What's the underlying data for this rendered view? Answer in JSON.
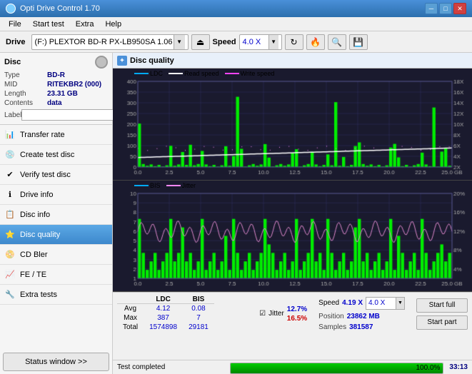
{
  "titleBar": {
    "title": "Opti Drive Control 1.70",
    "minBtn": "─",
    "maxBtn": "□",
    "closeBtn": "✕"
  },
  "menuBar": {
    "items": [
      "File",
      "Start test",
      "Extra",
      "Help"
    ]
  },
  "toolbar": {
    "driveLabel": "Drive",
    "driveValue": "(F:) PLEXTOR BD-R  PX-LB950SA 1.06",
    "speedLabel": "Speed",
    "speedValue": "4.0 X"
  },
  "discPanel": {
    "title": "Disc",
    "type": "BD-R",
    "mid": "RITEKBR2 (000)",
    "length": "23.31 GB",
    "contents": "data",
    "labelPlaceholder": ""
  },
  "navItems": [
    {
      "id": "transfer-rate",
      "label": "Transfer rate",
      "icon": "📊"
    },
    {
      "id": "create-test-disc",
      "label": "Create test disc",
      "icon": "💿"
    },
    {
      "id": "verify-test-disc",
      "label": "Verify test disc",
      "icon": "✔"
    },
    {
      "id": "drive-info",
      "label": "Drive info",
      "icon": "ℹ"
    },
    {
      "id": "disc-info",
      "label": "Disc info",
      "icon": "📋"
    },
    {
      "id": "disc-quality",
      "label": "Disc quality",
      "icon": "⭐",
      "active": true
    },
    {
      "id": "cd-bler",
      "label": "CD Bler",
      "icon": "📀"
    },
    {
      "id": "fe-te",
      "label": "FE / TE",
      "icon": "📈"
    },
    {
      "id": "extra-tests",
      "label": "Extra tests",
      "icon": "🔧"
    }
  ],
  "statusWindowBtn": "Status window >>",
  "discQuality": {
    "title": "Disc quality",
    "legend": {
      "ldc": "LDC",
      "readSpeed": "Read speed",
      "writeSpeed": "Write speed"
    },
    "legend2": {
      "bis": "BIS",
      "jitter": "Jitter"
    },
    "topChart": {
      "yMax": 400,
      "yAxisRight": [
        "18X",
        "16X",
        "14X",
        "12X",
        "10X",
        "8X",
        "6X",
        "4X",
        "2X"
      ],
      "xLabels": [
        "0.0",
        "2.5",
        "5.0",
        "7.5",
        "10.0",
        "12.5",
        "15.0",
        "17.5",
        "20.0",
        "22.5",
        "25.0 GB"
      ]
    },
    "bottomChart": {
      "yMax": 10,
      "yAxisRight": [
        "20%",
        "16%",
        "12%",
        "8%",
        "4%"
      ],
      "xLabels": [
        "0.0",
        "2.5",
        "5.0",
        "7.5",
        "10.0",
        "12.5",
        "15.0",
        "17.5",
        "20.0",
        "22.5",
        "25.0 GB"
      ]
    }
  },
  "stats": {
    "headers": [
      "LDC",
      "BIS"
    ],
    "avg": {
      "ldc": "4.12",
      "bis": "0.08"
    },
    "max": {
      "ldc": "387",
      "bis": "7"
    },
    "total": {
      "ldc": "1574898",
      "bis": "29181"
    },
    "jitterLabel": "Jitter",
    "jitterAvg": "12.7%",
    "jitterMax": "16.5%",
    "speedLabel": "Speed",
    "speedValue": "4.19 X",
    "speedSetting": "4.0 X",
    "positionLabel": "Position",
    "positionValue": "23862 MB",
    "samplesLabel": "Samples",
    "samplesValue": "381587",
    "startFullBtn": "Start full",
    "startPartBtn": "Start part"
  },
  "bottomBar": {
    "statusText": "Test completed",
    "progressPercent": 100,
    "progressLabel": "100.0%",
    "time": "33:13"
  }
}
